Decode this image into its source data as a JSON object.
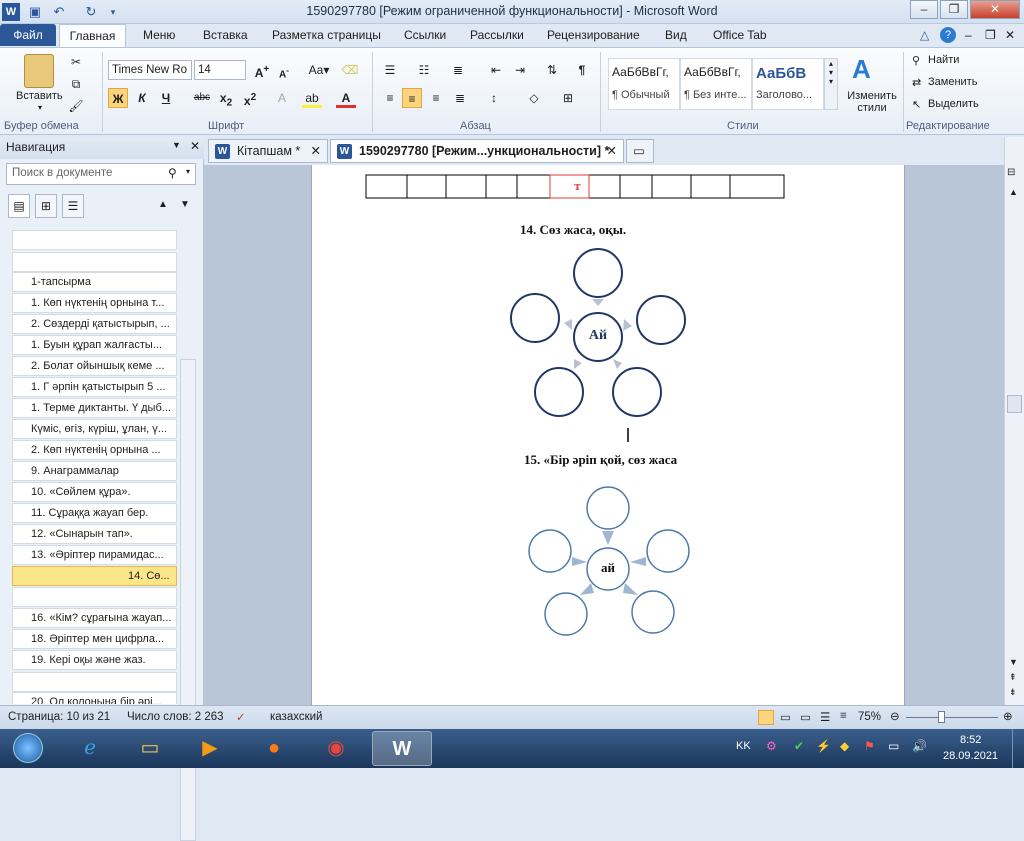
{
  "window": {
    "title": "1590297780 [Режим ограниченной функциональности]  -  Microsoft Word"
  },
  "ribbon": {
    "tabs": [
      "Файл",
      "Главная",
      "Меню",
      "Вставка",
      "Разметка страницы",
      "Ссылки",
      "Рассылки",
      "Рецензирование",
      "Вид",
      "Office Tab"
    ],
    "groups": {
      "clipboard": "Буфер обмена",
      "font": "Шрифт",
      "paragraph": "Абзац",
      "styles": "Стили",
      "editing": "Редактирование"
    },
    "paste_label": "Вставить",
    "font_name": "Times New Ro",
    "font_size": "14",
    "styles": [
      {
        "sample": "АаБбВвГг,",
        "name": "¶ Обычный"
      },
      {
        "sample": "АаБбВвГг,",
        "name": "¶ Без инте..."
      },
      {
        "sample": "АаБбВ",
        "name": "Заголово..."
      }
    ],
    "change_styles": "Изменить стили",
    "find": "Найти",
    "replace": "Заменить",
    "select": "Выделить"
  },
  "nav": {
    "title": "Навигация",
    "search_placeholder": "Поиск в документе",
    "items": [
      "",
      "",
      "1-тапсырма",
      "1. Көп нүктенің орнына т...",
      "2. Сөздерді қатыстырып, ...",
      " 1. Буын құрап жалғасты...",
      "2. Болат ойыншық кеме ...",
      "1. Г әрпін қатыстырып 5 ...",
      "1. Терме диктанты. Ү дыб...",
      "Күміс, өгіз, күріш, ұлан, ү...",
      "2. Көп нүктенің орнына ...",
      "9. Анаграммалар",
      "10. «Сөйлем құра».",
      "11. Сұраққа жауап бер.",
      "12. «Сынарын тап».",
      "13. «Әріптер пирамидас...",
      "14.  Сө...",
      "",
      "16. «Кім? сұрағына жауап...",
      "18. Әріптер мен цифрла...",
      "19. Кері оқы және жаз.",
      "",
      "20. Ол колонына бір әрі..."
    ]
  },
  "doc_tabs": [
    "Кітапшам *",
    "1590297780 [Режим...ункциональности] *"
  ],
  "document": {
    "table_letter": "т",
    "task14": "14.  Сөз жаса, оқы.",
    "center1": "Ай",
    "task15": "15. «Бір әріп қой, сөз жаса",
    "center2": "ай"
  },
  "status": {
    "page": "Страница: 10 из 21",
    "words": "Число слов: 2 263",
    "language": "казахский",
    "zoom": "75%"
  },
  "taskbar": {
    "lang": "KK",
    "time": "8:52",
    "date": "28.09.2021"
  }
}
